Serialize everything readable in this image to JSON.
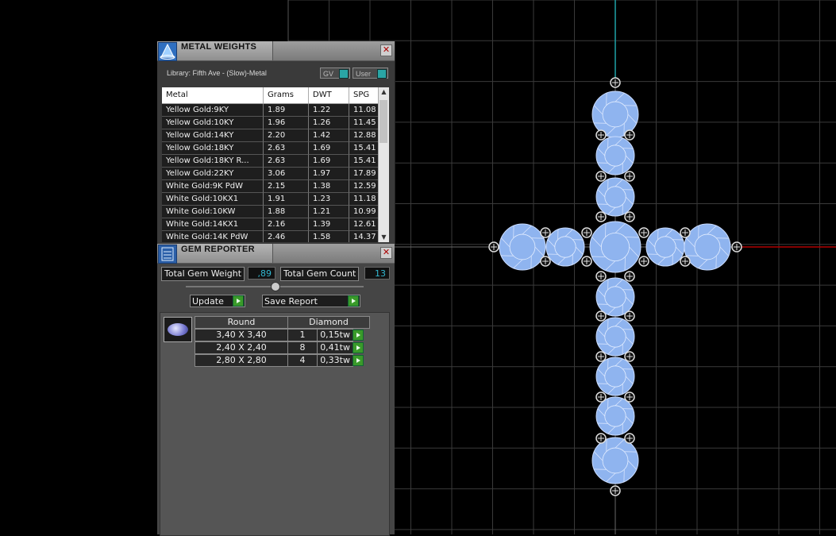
{
  "viewport": {
    "colors": {
      "background": "#000000",
      "grid": "#3a3a3a",
      "y_axis": "#1fa3a8",
      "x_axis": "#b00000",
      "gem": "#8fb4ef"
    }
  },
  "metal_weights": {
    "title": "METAL WEIGHTS",
    "icon": "jeweler-app-icon",
    "library_label": "Library: Fifth Ave - (Slow)-Metal",
    "toggle_gv": "GV",
    "toggle_user": "User",
    "columns": [
      "Metal",
      "Grams",
      "DWT",
      "SPG"
    ],
    "rows": [
      [
        "Yellow Gold:9KY",
        "1.89",
        "1.22",
        "11.08"
      ],
      [
        "Yellow Gold:10KY",
        "1.96",
        "1.26",
        "11.45"
      ],
      [
        "Yellow Gold:14KY",
        "2.20",
        "1.42",
        "12.88"
      ],
      [
        "Yellow Gold:18KY",
        "2.63",
        "1.69",
        "15.41"
      ],
      [
        "Yellow Gold:18KY R...",
        "2.63",
        "1.69",
        "15.41"
      ],
      [
        "Yellow Gold:22KY",
        "3.06",
        "1.97",
        "17.89"
      ],
      [
        "White Gold:9K PdW",
        "2.15",
        "1.38",
        "12.59"
      ],
      [
        "White Gold:10KX1",
        "1.91",
        "1.23",
        "11.18"
      ],
      [
        "White Gold:10KW",
        "1.88",
        "1.21",
        "10.99"
      ],
      [
        "White Gold:14KX1",
        "2.16",
        "1.39",
        "12.61"
      ],
      [
        "White Gold:14K PdW",
        "2.46",
        "1.58",
        "14.37"
      ]
    ]
  },
  "gem_reporter": {
    "title": "GEM REPORTER",
    "total_weight_label": "Total Gem Weight",
    "total_weight_value": ",89",
    "total_count_label": "Total Gem Count",
    "total_count_value": "13",
    "update_label": "Update",
    "save_report_label": "Save Report",
    "table": {
      "shape": "Round",
      "material": "Diamond",
      "rows": [
        {
          "size": "3,40 X 3,40",
          "count": "1",
          "weight": "0,15tw"
        },
        {
          "size": "2,40 X 2,40",
          "count": "8",
          "weight": "0,41tw"
        },
        {
          "size": "2,80 X 2,80",
          "count": "4",
          "weight": "0,33tw"
        }
      ]
    }
  }
}
